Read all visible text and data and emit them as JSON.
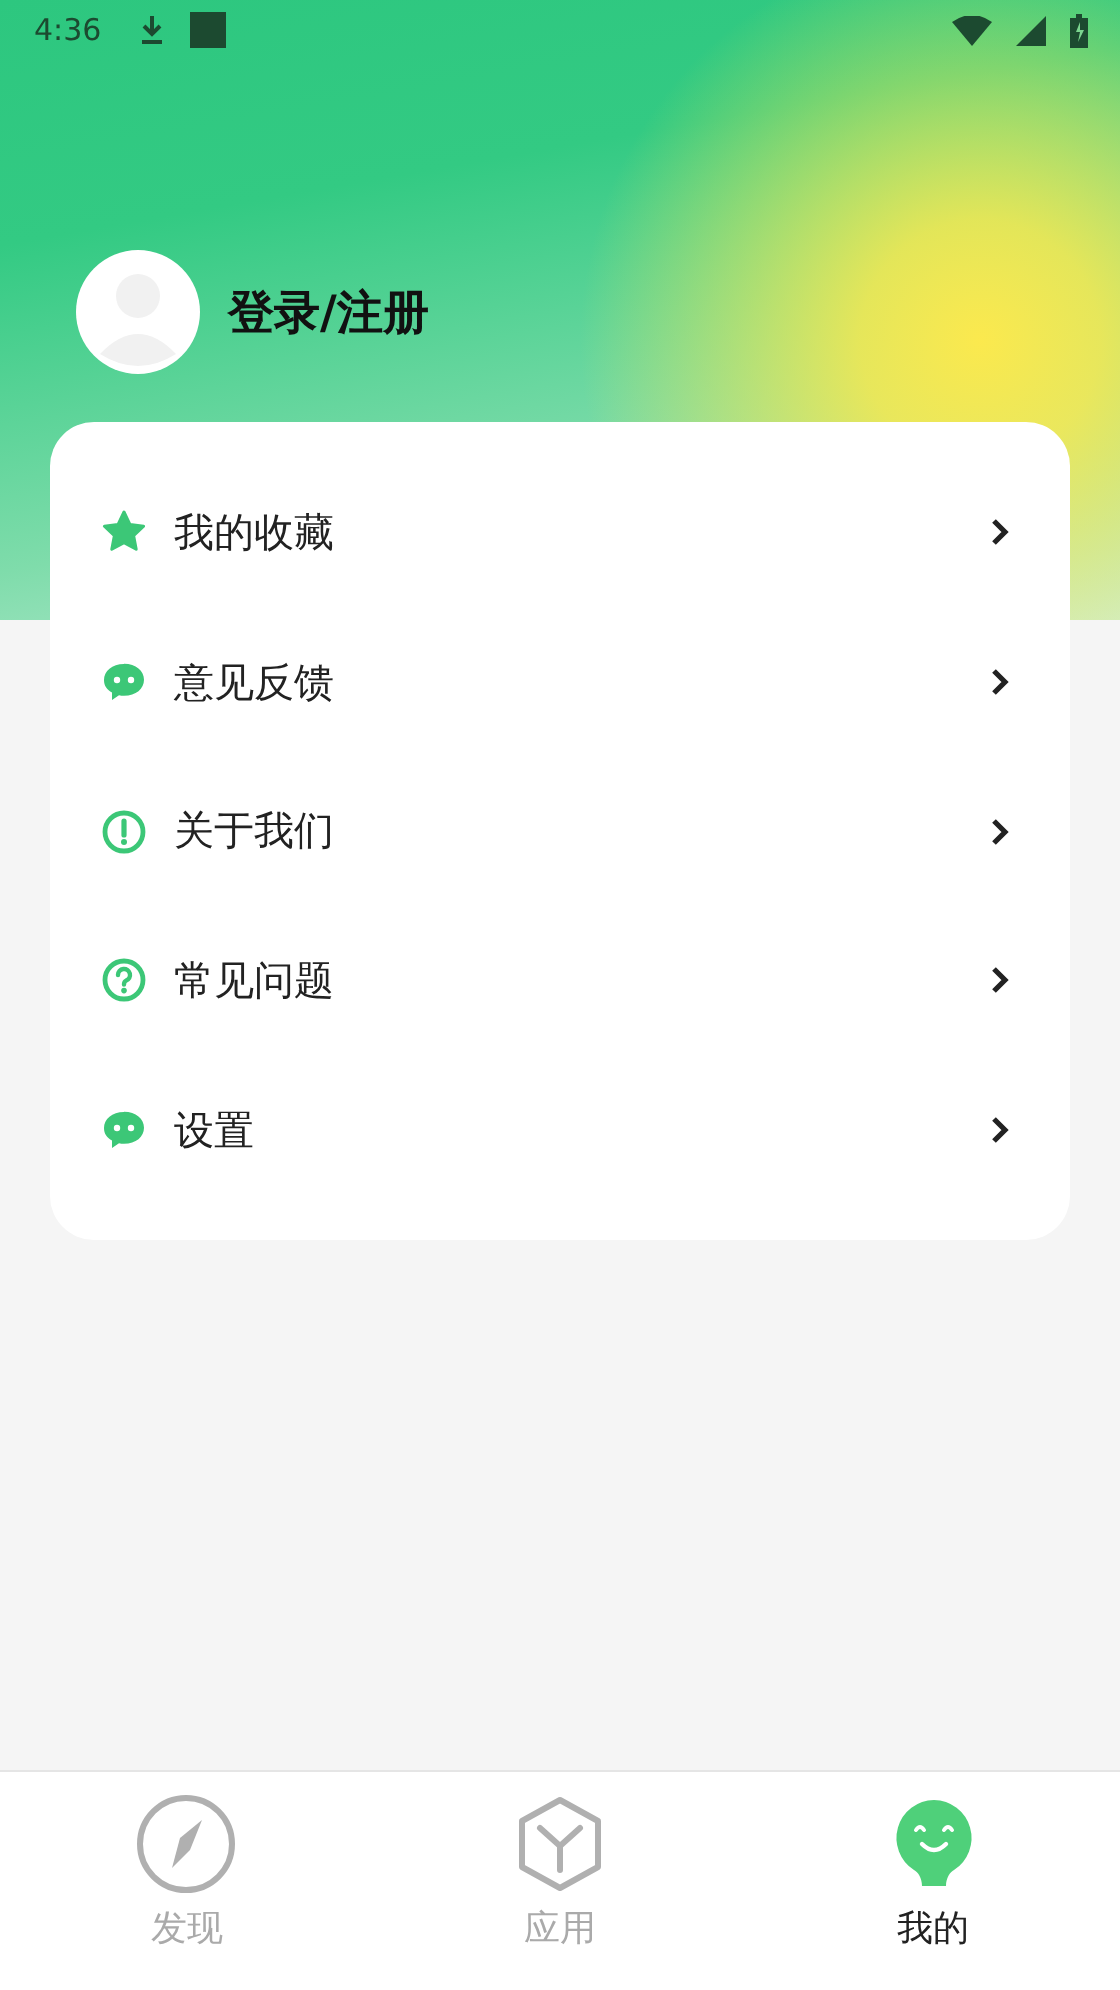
{
  "status_bar": {
    "time": "4:36"
  },
  "header": {
    "login_label": "登录/注册"
  },
  "menu": [
    {
      "kind": "star",
      "label": "我的收藏"
    },
    {
      "kind": "chat",
      "label": "意见反馈"
    },
    {
      "kind": "info",
      "label": "关于我们"
    },
    {
      "kind": "help",
      "label": "常见问题"
    },
    {
      "kind": "chat",
      "label": "设置"
    }
  ],
  "tabs": [
    {
      "kind": "compass",
      "label": "发现",
      "selected": false
    },
    {
      "kind": "box",
      "label": "应用",
      "selected": false
    },
    {
      "kind": "smiley",
      "label": "我的",
      "selected": true
    }
  ]
}
